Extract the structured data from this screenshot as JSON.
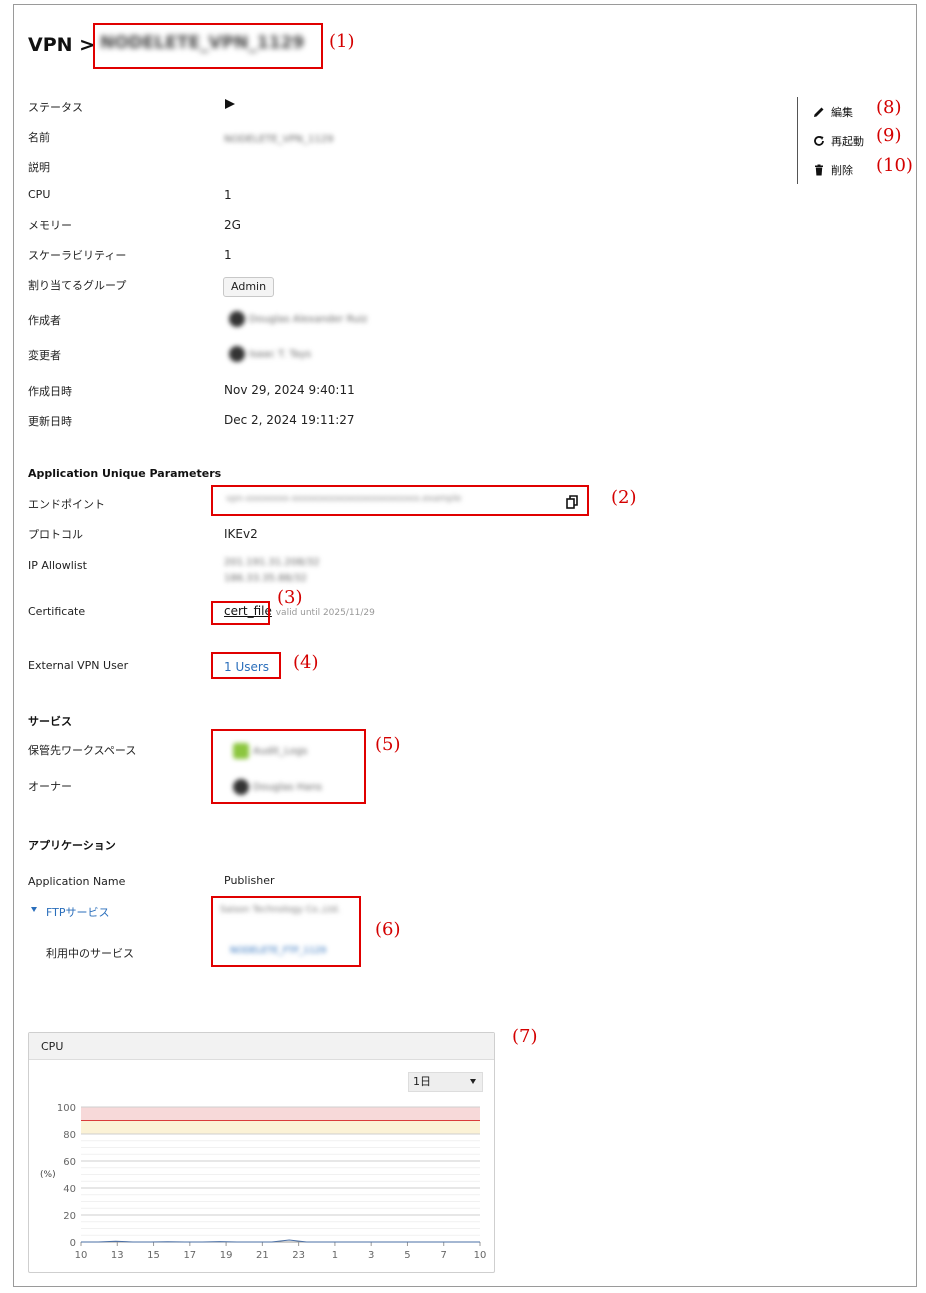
{
  "header": {
    "prefix": "VPN >",
    "name": "NODELETE_VPN_1129"
  },
  "annotations": [
    "(1)",
    "(2)",
    "(3)",
    "(4)",
    "(5)",
    "(6)",
    "(7)",
    "(8)",
    "(9)",
    "(10)"
  ],
  "details": {
    "status_label": "ステータス",
    "name_label": "名前",
    "name_value": "NODELETE_VPN_1129",
    "desc_label": "説明",
    "cpu_label": "CPU",
    "cpu_value": "1",
    "memory_label": "メモリー",
    "memory_value": "2G",
    "scal_label": "スケーラビリティー",
    "scal_value": "1",
    "group_label": "割り当てるグループ",
    "group_value": "Admin",
    "creator_label": "作成者",
    "creator_value": "Douglas Alexander Ruiz",
    "modifier_label": "変更者",
    "modifier_value": "Isaac T. Tays",
    "created_label": "作成日時",
    "created_value": "Nov 29, 2024 9:40:11",
    "updated_label": "更新日時",
    "updated_value": "Dec 2, 2024 19:11:27"
  },
  "params": {
    "heading": "Application Unique Parameters",
    "endpoint_label": "エンドポイント",
    "endpoint_value": "vpn-xxxxxxxx-xxxxxxxxxxxxxxxxxxxxxxxx.example",
    "protocol_label": "プロトコル",
    "protocol_value": "IKEv2",
    "allow_label": "IP Allowlist",
    "allow_1": "201.191.31.208/32",
    "allow_2": "186.33.35.88/32",
    "cert_label": "Certificate",
    "cert_link": "cert_file",
    "cert_valid": "valid until 2025/11/29",
    "ext_label": "External VPN User",
    "ext_link": "1 Users"
  },
  "service": {
    "heading": "サービス",
    "ws_label": "保管先ワークスペース",
    "ws_value": "Audit_Logs",
    "owner_label": "オーナー",
    "owner_value": "Douglas Hans"
  },
  "apps": {
    "heading": "アプリケーション",
    "col_name": "Application Name",
    "col_pub": "Publisher",
    "ftp_label": "FTPサービス",
    "ftp_publisher": "Saison Technology Co.,Ltd.",
    "using_label": "利用中のサービス",
    "using_value": "NODELETE_FTP_1129"
  },
  "actions": {
    "edit": "編集",
    "restart": "再起動",
    "delete": "削除"
  },
  "chart": {
    "title": "CPU",
    "period": "1日"
  },
  "chart_data": {
    "type": "line",
    "title": "CPU",
    "ylabel": "(%)",
    "ylim": [
      0,
      100
    ],
    "yticks": [
      0,
      20,
      40,
      60,
      80,
      100
    ],
    "xticks": [
      "10",
      "13",
      "15",
      "17",
      "19",
      "21",
      "23",
      "1",
      "3",
      "5",
      "7",
      "10"
    ],
    "thresholds": [
      {
        "value": 100,
        "color": "#d93b3b"
      },
      {
        "value": 90,
        "color": "#d93b3b"
      },
      {
        "value": 80,
        "color": "#f0c23b"
      }
    ],
    "series": [
      {
        "values": [
          0,
          0,
          0.5,
          0,
          0,
          0.2,
          0,
          0,
          0.3,
          0,
          0,
          0,
          1.5,
          0,
          0,
          0,
          0,
          0,
          0,
          0,
          0,
          0,
          0,
          0
        ]
      }
    ],
    "grid": true
  }
}
